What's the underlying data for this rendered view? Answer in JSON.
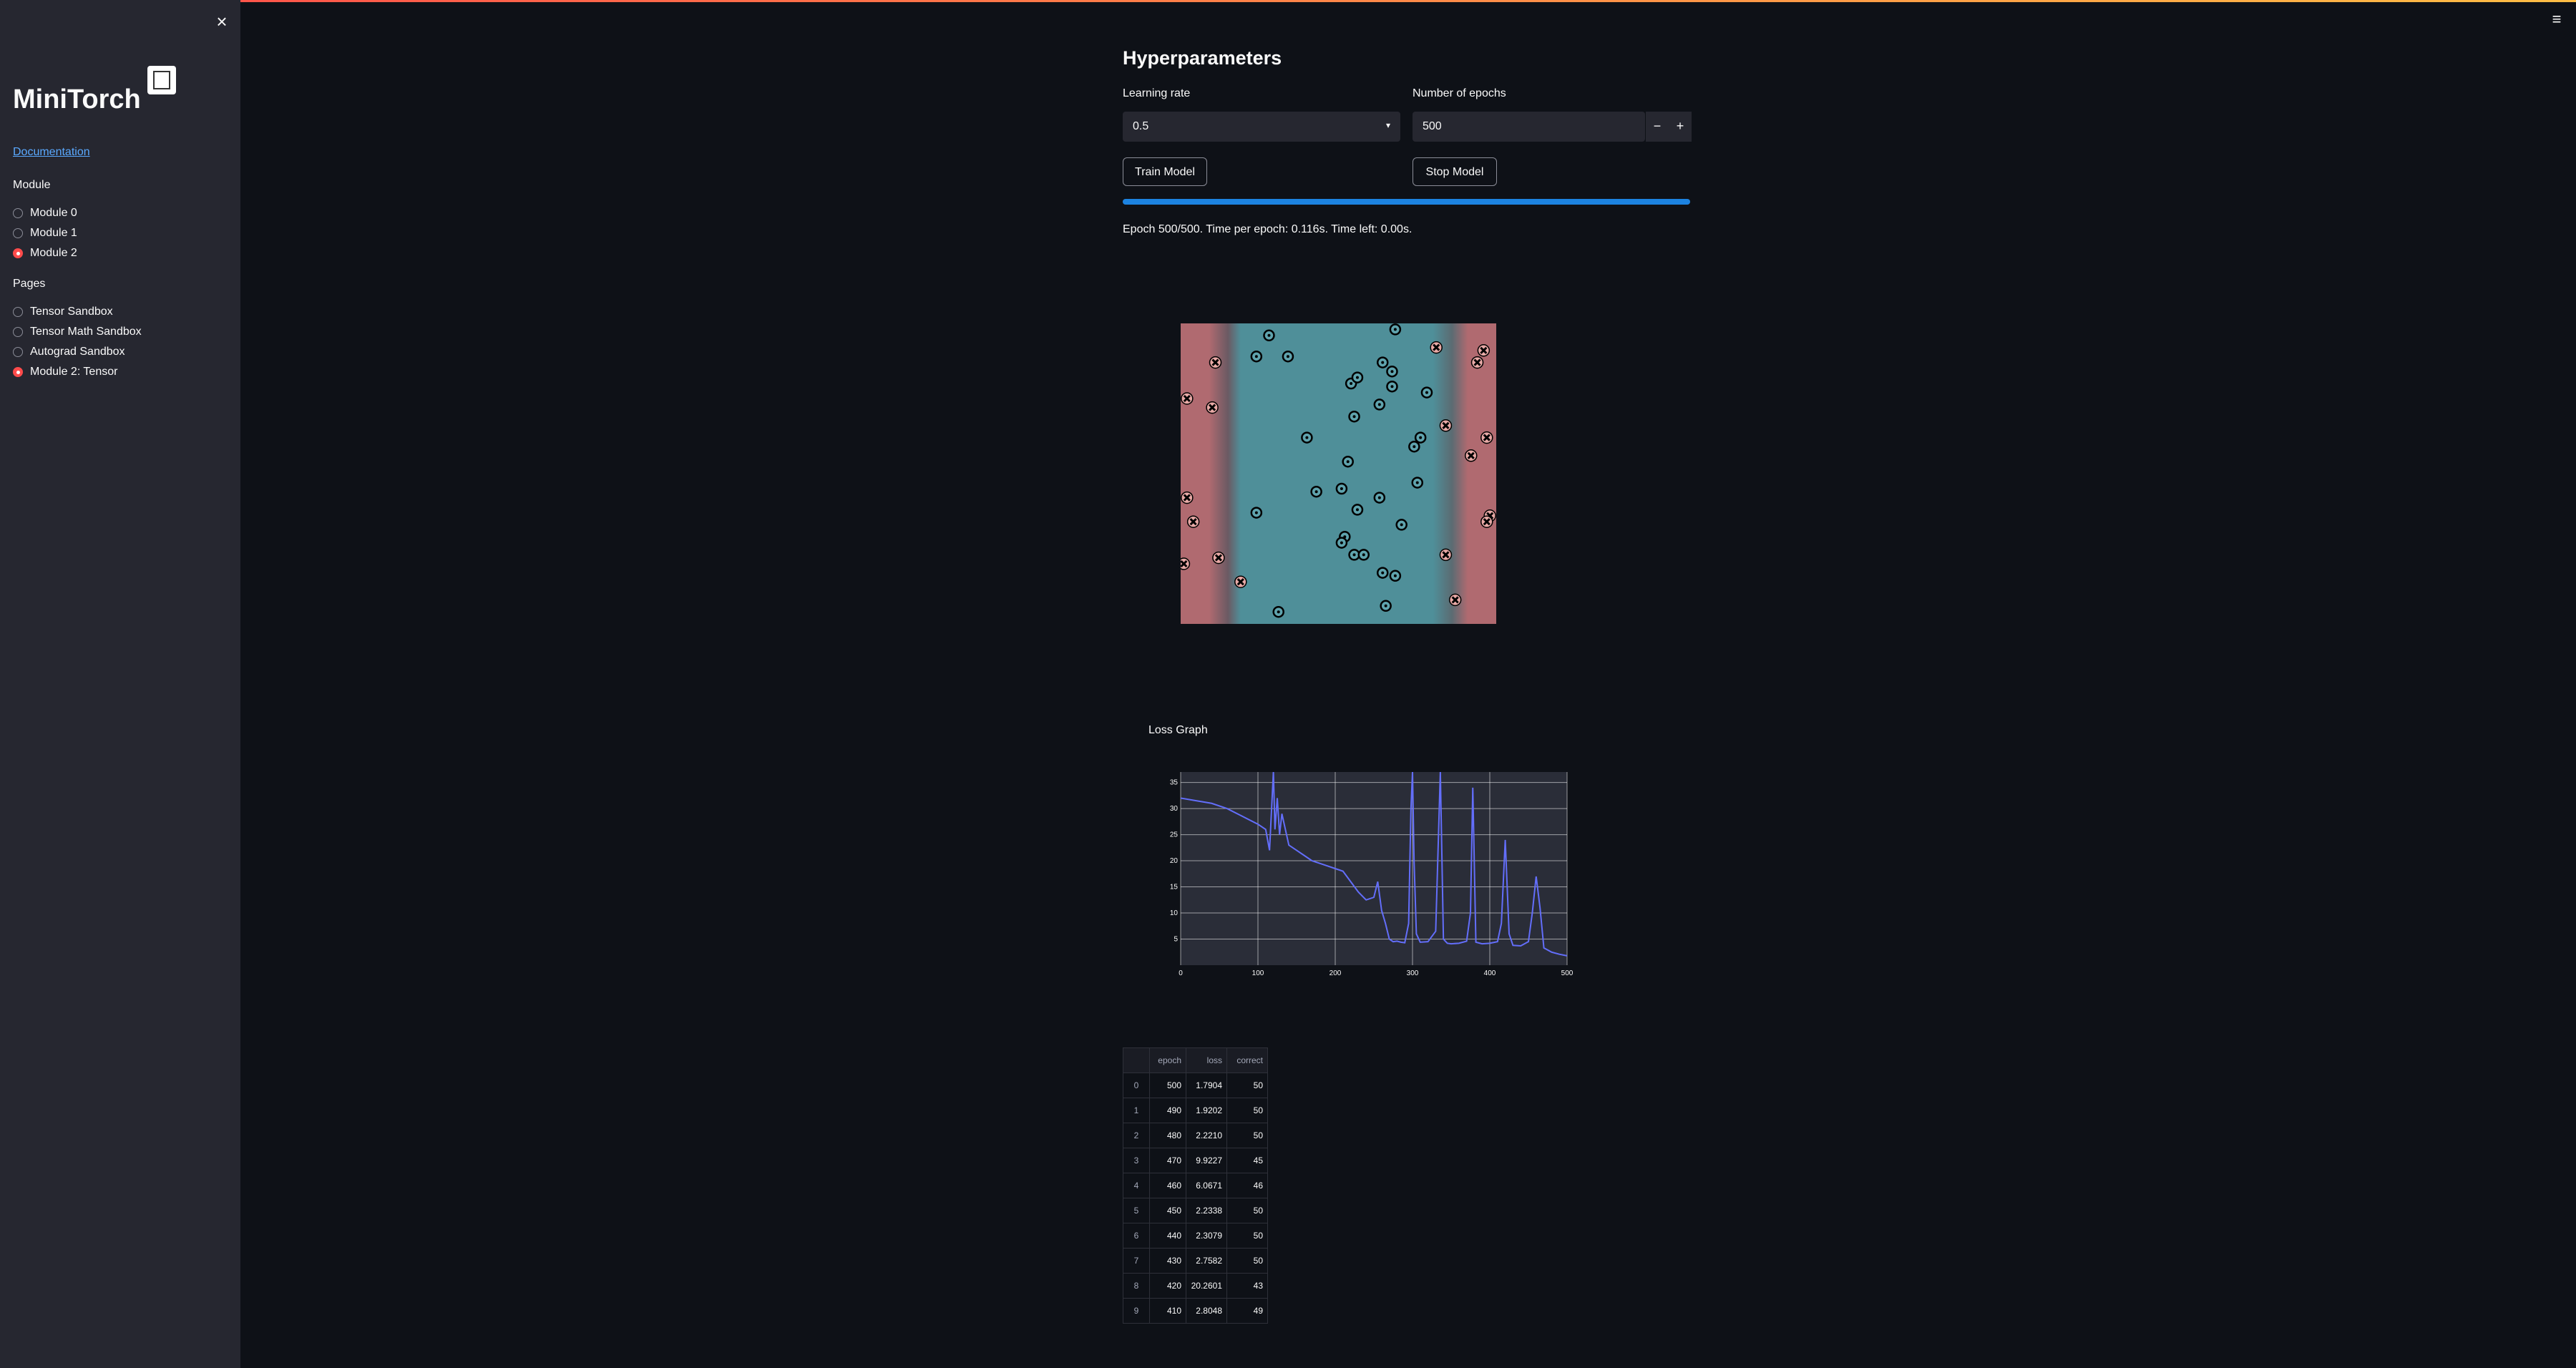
{
  "sidebar": {
    "close_icon": "×",
    "title": "MiniTorch",
    "doc_link": "Documentation",
    "module_label": "Module",
    "modules": [
      "Module 0",
      "Module 1",
      "Module 2"
    ],
    "selected_module": 2,
    "pages_label": "Pages",
    "pages": [
      "Tensor Sandbox",
      "Tensor Math Sandbox",
      "Autograd Sandbox",
      "Module 2: Tensor"
    ],
    "selected_page": 3
  },
  "menu_icon": "≡",
  "main": {
    "title": "Hyperparameters",
    "learning_rate_label": "Learning rate",
    "learning_rate_value": "0.5",
    "epochs_label": "Number of epochs",
    "epochs_value": "500",
    "minus": "−",
    "plus": "+",
    "train_button": "Train Model",
    "stop_button": "Stop Model",
    "progress_fraction": 1.0,
    "status_text": "Epoch 500/500. Time per epoch: 0.116s. Time left: 0.00s.",
    "loss_title": "Loss Graph"
  },
  "colors": {
    "accent": "#ff4b4b",
    "progress": "#1c83e1",
    "class_teal": "#4f8f99",
    "class_red": "#b06a70",
    "loss_line": "#636efa"
  },
  "boundary_plot": {
    "points_o": [
      [
        0.28,
        0.96
      ],
      [
        0.24,
        0.89
      ],
      [
        0.34,
        0.89
      ],
      [
        0.68,
        0.98
      ],
      [
        0.64,
        0.87
      ],
      [
        0.67,
        0.84
      ],
      [
        0.54,
        0.8
      ],
      [
        0.56,
        0.82
      ],
      [
        0.67,
        0.79
      ],
      [
        0.78,
        0.77
      ],
      [
        0.63,
        0.73
      ],
      [
        0.55,
        0.69
      ],
      [
        0.76,
        0.62
      ],
      [
        0.74,
        0.59
      ],
      [
        0.4,
        0.62
      ],
      [
        0.53,
        0.54
      ],
      [
        0.75,
        0.47
      ],
      [
        0.43,
        0.44
      ],
      [
        0.51,
        0.45
      ],
      [
        0.63,
        0.42
      ],
      [
        0.56,
        0.38
      ],
      [
        0.24,
        0.37
      ],
      [
        0.7,
        0.33
      ],
      [
        0.52,
        0.29
      ],
      [
        0.51,
        0.27
      ],
      [
        0.55,
        0.23
      ],
      [
        0.58,
        0.23
      ],
      [
        0.64,
        0.17
      ],
      [
        0.68,
        0.16
      ],
      [
        0.31,
        0.04
      ],
      [
        0.65,
        0.06
      ]
    ],
    "points_x": [
      [
        0.11,
        0.87
      ],
      [
        0.1,
        0.72
      ],
      [
        0.02,
        0.75
      ],
      [
        0.81,
        0.92
      ],
      [
        0.96,
        0.91
      ],
      [
        0.94,
        0.87
      ],
      [
        0.84,
        0.66
      ],
      [
        0.97,
        0.62
      ],
      [
        0.92,
        0.56
      ],
      [
        0.02,
        0.42
      ],
      [
        0.04,
        0.34
      ],
      [
        0.98,
        0.36
      ],
      [
        0.97,
        0.34
      ],
      [
        0.12,
        0.22
      ],
      [
        0.84,
        0.23
      ],
      [
        0.19,
        0.14
      ],
      [
        0.01,
        0.2
      ],
      [
        0.87,
        0.08
      ]
    ]
  },
  "chart_data": {
    "type": "line",
    "title": "",
    "xlabel": "",
    "ylabel": "",
    "xlim": [
      0,
      500
    ],
    "ylim": [
      0,
      37
    ],
    "x_ticks": [
      "0",
      "100",
      "200",
      "300",
      "400",
      "500"
    ],
    "y_ticks": [
      "5",
      "10",
      "15",
      "20",
      "25",
      "30",
      "35"
    ],
    "grid": true,
    "series": [
      {
        "x": [
          0,
          20,
          40,
          60,
          80,
          100,
          110,
          115,
          120,
          122,
          125,
          128,
          131,
          140,
          150,
          160,
          170,
          180,
          190,
          200,
          210,
          220,
          230,
          240,
          250,
          255,
          260,
          265,
          270,
          275,
          280,
          285,
          290,
          295,
          298,
          300,
          302,
          305,
          310,
          320,
          330,
          336,
          340,
          345,
          350,
          360,
          370,
          375,
          378,
          382,
          390,
          400,
          410,
          415,
          420,
          425,
          430,
          440,
          450,
          455,
          460,
          465,
          470,
          480,
          490,
          500
        ],
        "y": [
          32,
          31.5,
          31,
          30,
          28.5,
          27,
          26,
          22,
          37,
          26,
          32,
          25,
          29,
          23,
          22,
          21,
          20,
          19.5,
          19,
          18.5,
          18,
          16,
          14,
          12.5,
          13,
          16,
          10.5,
          8,
          5,
          4.5,
          4.6,
          4.4,
          4.3,
          8,
          30,
          37,
          20,
          6,
          4.4,
          4.5,
          6.5,
          37,
          5,
          4.2,
          4.1,
          4.2,
          4.6,
          10,
          34,
          4.4,
          4.1,
          4.2,
          4.5,
          8,
          24,
          6,
          3.8,
          3.7,
          4.5,
          10,
          17,
          11,
          3.3,
          2.5,
          2.1,
          1.8
        ]
      }
    ]
  },
  "table": {
    "headers": [
      "",
      "epoch",
      "loss",
      "correct"
    ],
    "rows": [
      [
        "0",
        "500",
        "1.7904",
        "50"
      ],
      [
        "1",
        "490",
        "1.9202",
        "50"
      ],
      [
        "2",
        "480",
        "2.2210",
        "50"
      ],
      [
        "3",
        "470",
        "9.9227",
        "45"
      ],
      [
        "4",
        "460",
        "6.0671",
        "46"
      ],
      [
        "5",
        "450",
        "2.2338",
        "50"
      ],
      [
        "6",
        "440",
        "2.3079",
        "50"
      ],
      [
        "7",
        "430",
        "2.7582",
        "50"
      ],
      [
        "8",
        "420",
        "20.2601",
        "43"
      ],
      [
        "9",
        "410",
        "2.8048",
        "49"
      ]
    ]
  }
}
